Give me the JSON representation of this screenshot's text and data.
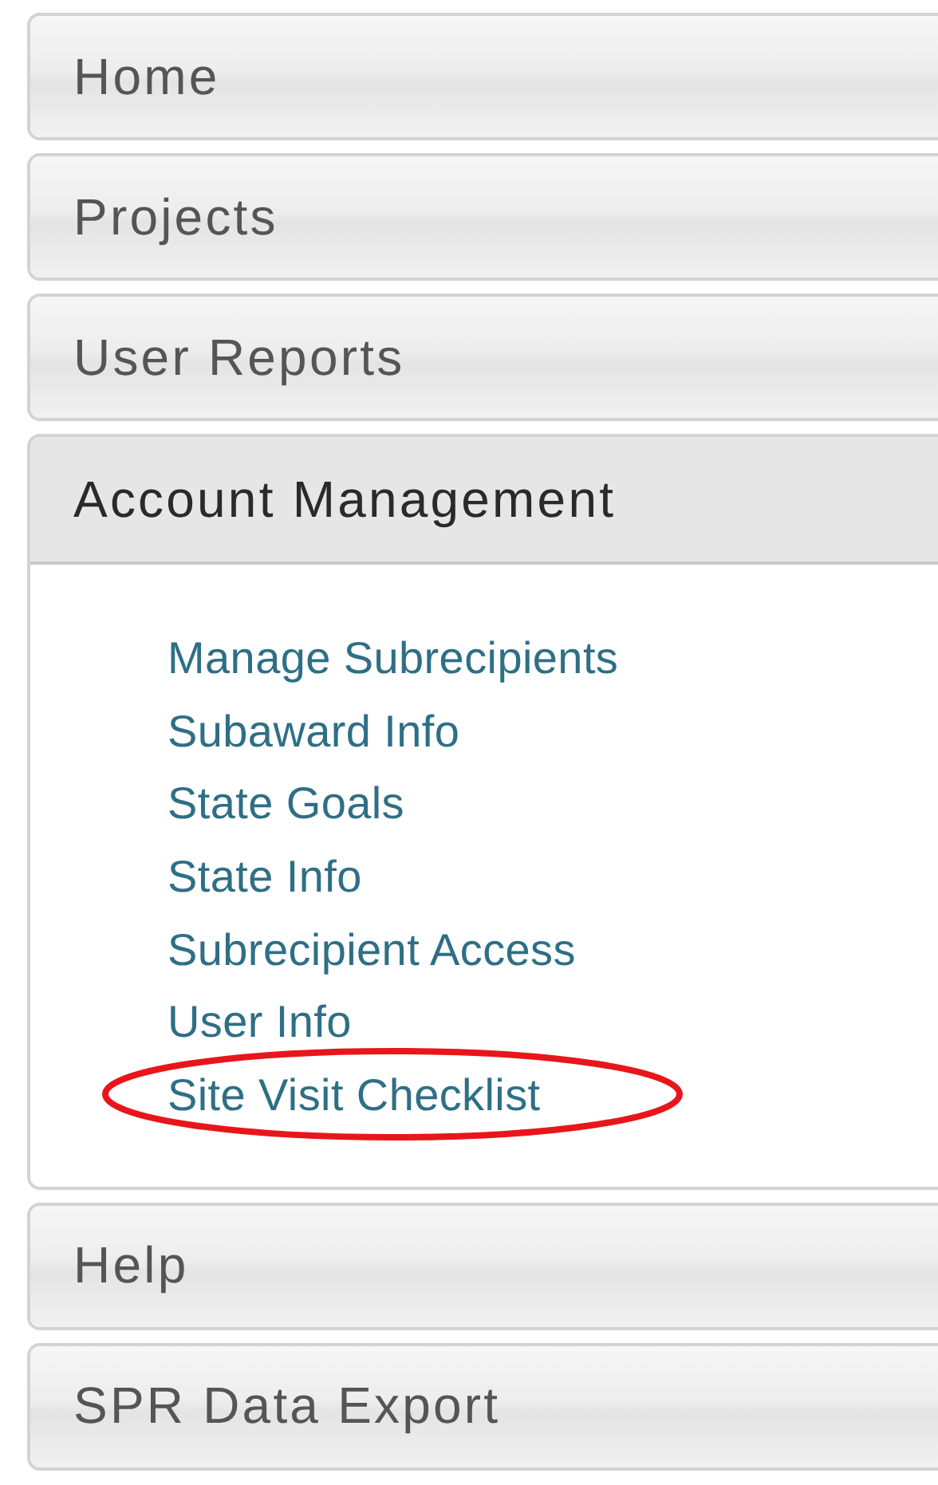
{
  "sections": [
    {
      "label": "Home",
      "expanded": false
    },
    {
      "label": "Projects",
      "expanded": false
    },
    {
      "label": "User Reports",
      "expanded": false
    },
    {
      "label": "Account Management",
      "expanded": true,
      "links": [
        {
          "label": "Manage Subrecipients",
          "circled": false
        },
        {
          "label": "Subaward Info",
          "circled": false
        },
        {
          "label": "State Goals",
          "circled": false
        },
        {
          "label": "State Info",
          "circled": false
        },
        {
          "label": "Subrecipient Access",
          "circled": false
        },
        {
          "label": "User Info",
          "circled": false
        },
        {
          "label": "Site Visit Checklist",
          "circled": true
        }
      ]
    },
    {
      "label": "Help",
      "expanded": false
    },
    {
      "label": "SPR Data Export",
      "expanded": false
    }
  ]
}
